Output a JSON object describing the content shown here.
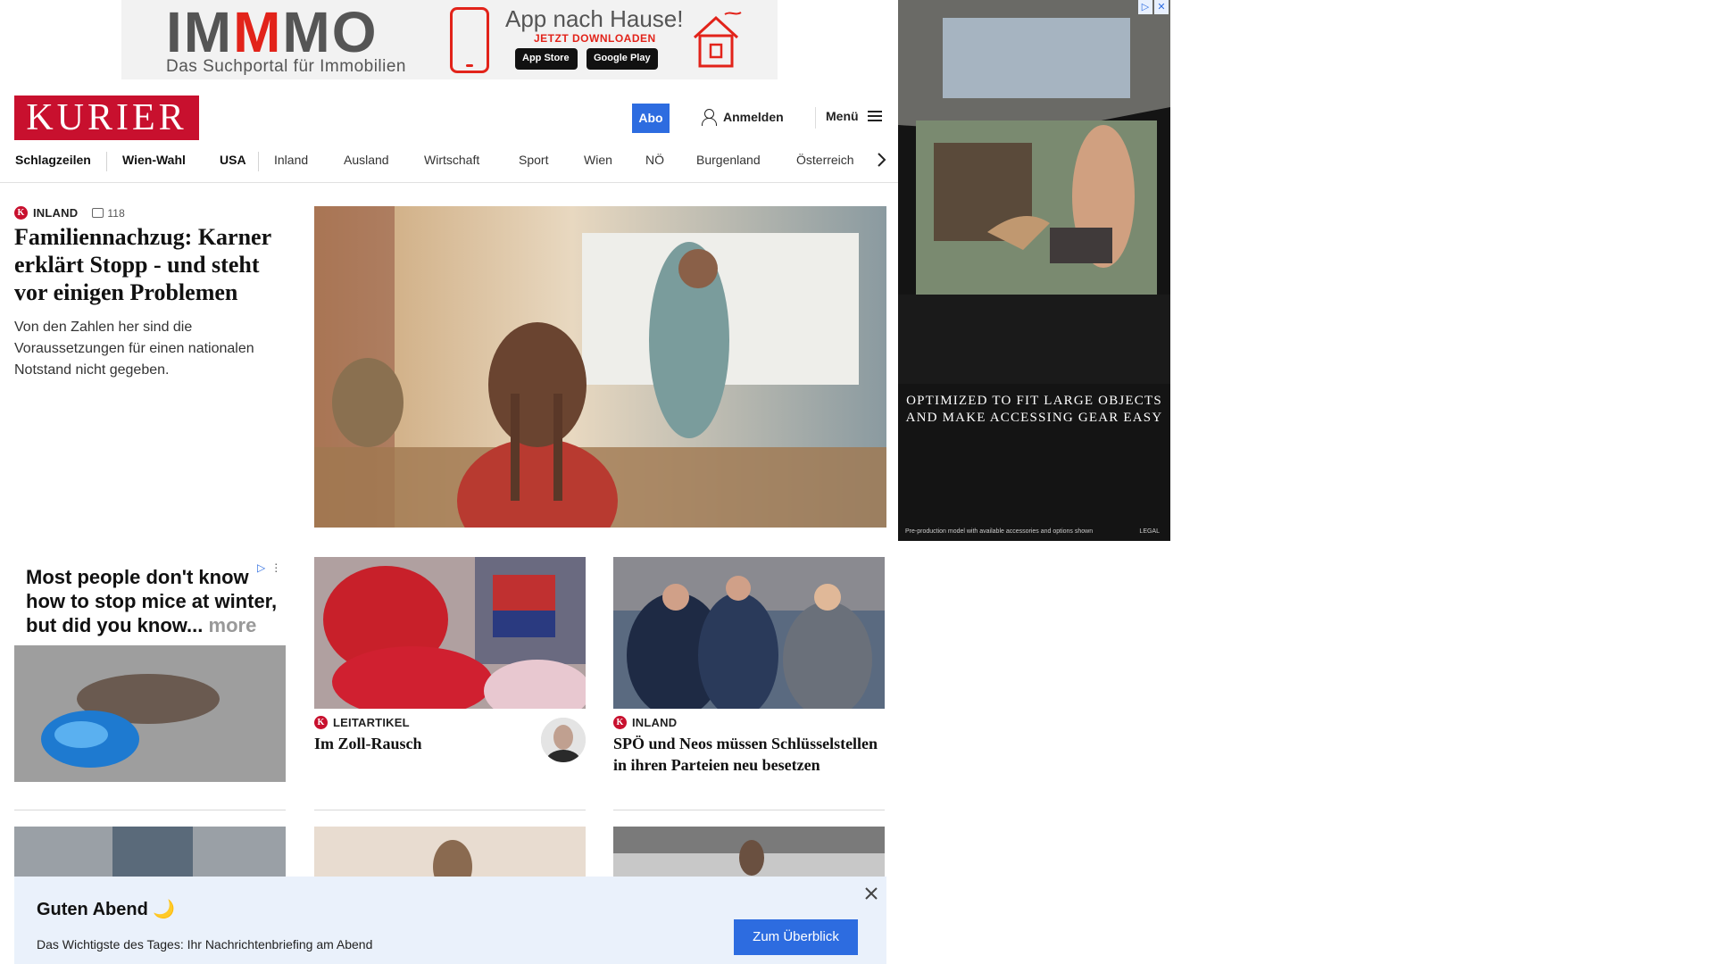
{
  "top_ad": {
    "logo_part1": "IM",
    "logo_part2": "M",
    "logo_part3": "MO",
    "subtitle": "Das Suchportal für Immobilien",
    "headline": "App nach Hause!",
    "cta": "JETZT DOWNLOADEN",
    "apple_store": "App Store",
    "google_store": "Google Play"
  },
  "header": {
    "logo": "KURIER",
    "abo_label": "Abo",
    "login_label": "Anmelden",
    "menu_label": "Menü"
  },
  "nav": {
    "items": [
      "Schlagzeilen",
      "Wien-Wahl",
      "USA",
      "Inland",
      "Ausland",
      "Wirtschaft",
      "Sport",
      "Wien",
      "NÖ",
      "Burgenland",
      "Österreich"
    ]
  },
  "lead": {
    "kicker": "INLAND",
    "comments": "118",
    "title": "Familiennachzug: Karner erklärt Stopp - und steht vor einigen Problemen",
    "teaser": "Von den Zahlen her sind die Voraussetzungen für einen nationalen Notstand nicht gegeben."
  },
  "right_ad": {
    "claim": "OPTIMIZED TO FIT LARGE OBJECTS AND MAKE ACCESSING GEAR EASY",
    "footnote": "Pre-production model with available accessories and options shown",
    "legal": "LEGAL"
  },
  "native_ad": {
    "text": "Most people don't know how to stop mice at winter, but did you know...",
    "more": "more"
  },
  "cards": [
    {
      "kicker": "LEITARTIKEL",
      "title": "Im Zoll-Rausch"
    },
    {
      "kicker": "INLAND",
      "title": "SPÖ und Neos müssen Schlüsselstellen in ihren Parteien neu besetzen"
    }
  ],
  "evening": {
    "title": "Guten Abend 🌙",
    "text": "Das Wichtigste des Tages: Ihr Nachrichtenbriefing am Abend",
    "button": "Zum Überblick"
  },
  "colors": {
    "brand_red": "#c8102e",
    "accent_blue": "#2d6ce0",
    "banner_bg": "#eaf1fb"
  }
}
